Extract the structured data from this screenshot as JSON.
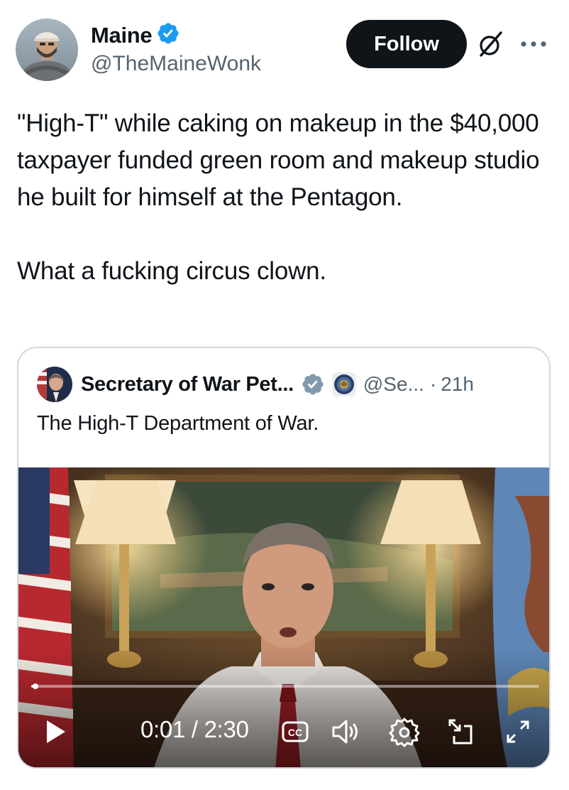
{
  "author": {
    "display_name": "Maine",
    "handle": "@TheMaineWonk",
    "verified": true,
    "avatar_icon": "profile-photo"
  },
  "actions": {
    "follow_label": "Follow",
    "grok_icon": "grok-icon",
    "more_icon": "more-icon"
  },
  "tweet": {
    "text": "\"High-T\" while caking on makeup in the $40,000 taxpayer funded green room and makeup studio he built for himself at the Pentagon.\n\nWhat a fucking circus clown."
  },
  "quote": {
    "display_name": "Secretary of War Pet...",
    "handle": "@Se...",
    "separator": "·",
    "time": "21h",
    "verified_color": "#829aab",
    "text": "The High-T Department of War.",
    "video": {
      "current_time": "0:01",
      "duration": "2:30",
      "time_label": "0:01 / 2:30",
      "progress_fraction": 0.0067,
      "controls": [
        "play-icon",
        "captions-icon",
        "volume-icon",
        "settings-icon",
        "pip-icon",
        "fullscreen-icon"
      ]
    }
  },
  "colors": {
    "verified_blue": "#1d9bf0",
    "text_primary": "#0f1419",
    "text_secondary": "#536471",
    "border": "#cfd9de"
  }
}
